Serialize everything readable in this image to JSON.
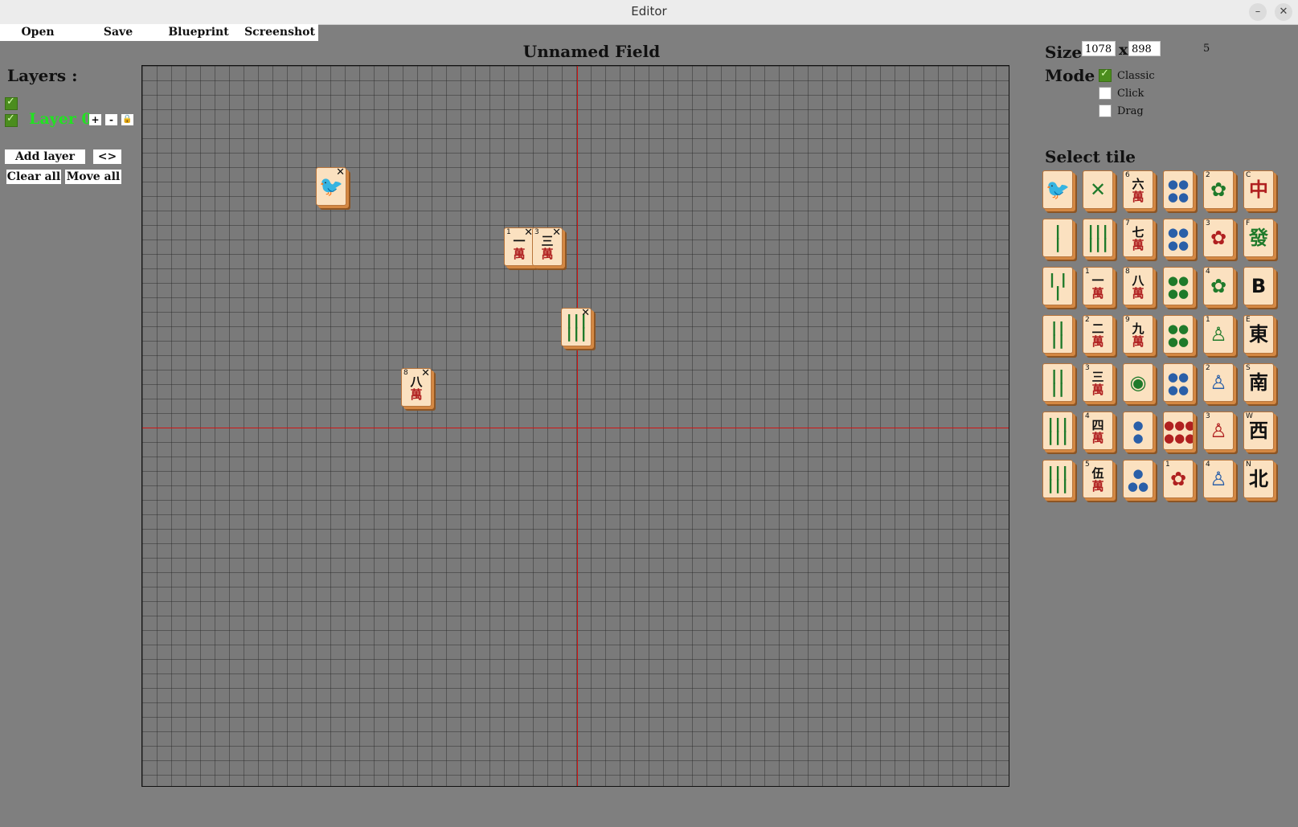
{
  "window": {
    "title": "Editor",
    "minimize": "–",
    "close": "✕"
  },
  "menu": {
    "open": "Open",
    "save": "Save",
    "blueprint": "Blueprint",
    "screenshot": "Screenshot"
  },
  "layers": {
    "title": "Layers :",
    "all_visible": true,
    "items": [
      {
        "name": "Layer 0",
        "visible": true,
        "plus": "+",
        "minus": "-",
        "lock": "🔒"
      }
    ],
    "add_layer": "Add layer",
    "swap": "<>",
    "clear_all": "Clear all",
    "move_all": "Move all"
  },
  "field": {
    "title": "Unnamed Field"
  },
  "placed_tiles": [
    {
      "id": "bird",
      "num": "",
      "glyph": "🐦",
      "glyph_color": "#2a5fa8",
      "sub": ""
    },
    {
      "id": "char-1",
      "num": "1",
      "glyph": "一",
      "glyph_color": "#111111",
      "sub": "萬"
    },
    {
      "id": "char-3",
      "num": "3",
      "glyph": "三",
      "glyph_color": "#111111",
      "sub": "萬"
    },
    {
      "id": "bam-9",
      "num": "",
      "glyph": "┃┃┃",
      "glyph_color": "#1f7a2a",
      "sub": "┃┃┃"
    },
    {
      "id": "char-8",
      "num": "8",
      "glyph": "八",
      "glyph_color": "#111111",
      "sub": "萬"
    }
  ],
  "settings": {
    "size_label": "Size",
    "width": "1078",
    "x": "x",
    "height": "898",
    "extra": "5",
    "mode_label": "Mode :",
    "modes": [
      {
        "label": "Classic",
        "checked": true
      },
      {
        "label": "Click",
        "checked": false
      },
      {
        "label": "Drag",
        "checked": false
      }
    ]
  },
  "palette": {
    "title": "Select tile",
    "tiles": [
      [
        "🐦",
        "",
        "#2a5fa8",
        ""
      ],
      [
        "✕",
        "",
        "#1f7a2a",
        ""
      ],
      [
        "六",
        "6",
        "#111111",
        "萬"
      ],
      [
        "●●",
        "",
        "#2a5fa8",
        "●●"
      ],
      [
        "✿",
        "2",
        "#1f7a2a",
        ""
      ],
      [
        "中",
        "C",
        "#b02020",
        ""
      ],
      [
        "┃",
        "",
        "#1f7a2a",
        "┃"
      ],
      [
        "┃┃┃",
        "",
        "#1f7a2a",
        "┃┃┃"
      ],
      [
        "七",
        "7",
        "#111111",
        "萬"
      ],
      [
        "●●",
        "",
        "#2a5fa8",
        "●●"
      ],
      [
        "✿",
        "3",
        "#b02020",
        ""
      ],
      [
        "發",
        "F",
        "#1f7a2a",
        ""
      ],
      [
        "┃ ┃",
        "",
        "#1f7a2a",
        "┃"
      ],
      [
        "一",
        "1",
        "#111111",
        "萬"
      ],
      [
        "八",
        "8",
        "#111111",
        "萬"
      ],
      [
        "●●",
        "",
        "#1f7a2a",
        "●●"
      ],
      [
        "✿",
        "4",
        "#1f7a2a",
        ""
      ],
      [
        "B",
        "",
        "#111111",
        ""
      ],
      [
        "┃┃",
        "",
        "#1f7a2a",
        "┃┃"
      ],
      [
        "二",
        "2",
        "#111111",
        "萬"
      ],
      [
        "九",
        "9",
        "#111111",
        "萬"
      ],
      [
        "●●",
        "",
        "#1f7a2a",
        "●●"
      ],
      [
        "♙",
        "1",
        "#1f7a2a",
        ""
      ],
      [
        "東",
        "E",
        "#111111",
        ""
      ],
      [
        "┃┃",
        "",
        "#1f7a2a",
        "┃┃"
      ],
      [
        "三",
        "3",
        "#111111",
        "萬"
      ],
      [
        "◉",
        "",
        "#1f7a2a",
        ""
      ],
      [
        "●●",
        "",
        "#2a5fa8",
        "●●"
      ],
      [
        "♙",
        "2",
        "#2a5fa8",
        ""
      ],
      [
        "南",
        "S",
        "#111111",
        ""
      ],
      [
        "┃┃┃",
        "",
        "#1f7a2a",
        "┃┃┃"
      ],
      [
        "四",
        "4",
        "#111111",
        "萬"
      ],
      [
        "●",
        "",
        "#2a5fa8",
        "●"
      ],
      [
        "●●●",
        "",
        "#b02020",
        "●●●"
      ],
      [
        "♙",
        "3",
        "#b02020",
        ""
      ],
      [
        "西",
        "W",
        "#111111",
        ""
      ],
      [
        "┃┃┃",
        "",
        "#1f7a2a",
        "┃┃┃"
      ],
      [
        "伍",
        "5",
        "#111111",
        "萬"
      ],
      [
        "●",
        "",
        "#2a5fa8",
        "●●"
      ],
      [
        "✿",
        "1",
        "#b02020",
        ""
      ],
      [
        "♙",
        "4",
        "#2a5fa8",
        ""
      ],
      [
        "北",
        "N",
        "#111111",
        ""
      ]
    ]
  }
}
